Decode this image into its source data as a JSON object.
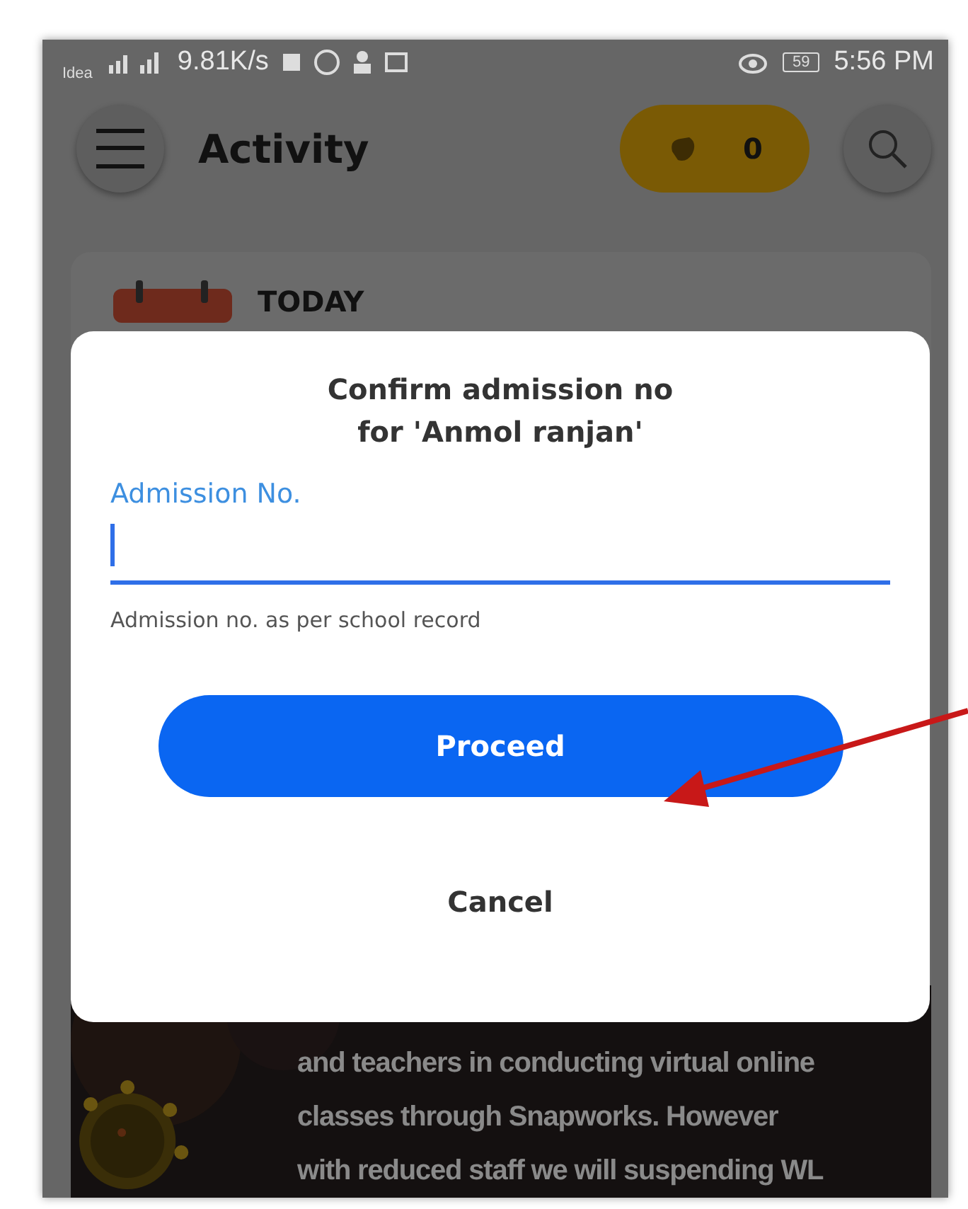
{
  "status_bar": {
    "carrier": "Idea",
    "speed": "9.81K/s",
    "battery": "59",
    "time": "5:56 PM"
  },
  "header": {
    "title": "Activity",
    "coins": "0"
  },
  "card": {
    "title": "TODAY"
  },
  "dialog": {
    "title": "Confirm admission no\nfor 'Anmol ranjan'",
    "field": {
      "label": "Admission No.",
      "focused": true
    },
    "helper": "Admission no. as per school record",
    "buttons": [
      {
        "label": "Proceed",
        "kind": "primary"
      },
      {
        "label": "Cancel",
        "kind": "text"
      }
    ]
  },
  "banner": {
    "lines": [
      "and teachers in conducting virtual online",
      "classes through Snapworks. However",
      "with reduced staff we will suspending WL"
    ]
  }
}
